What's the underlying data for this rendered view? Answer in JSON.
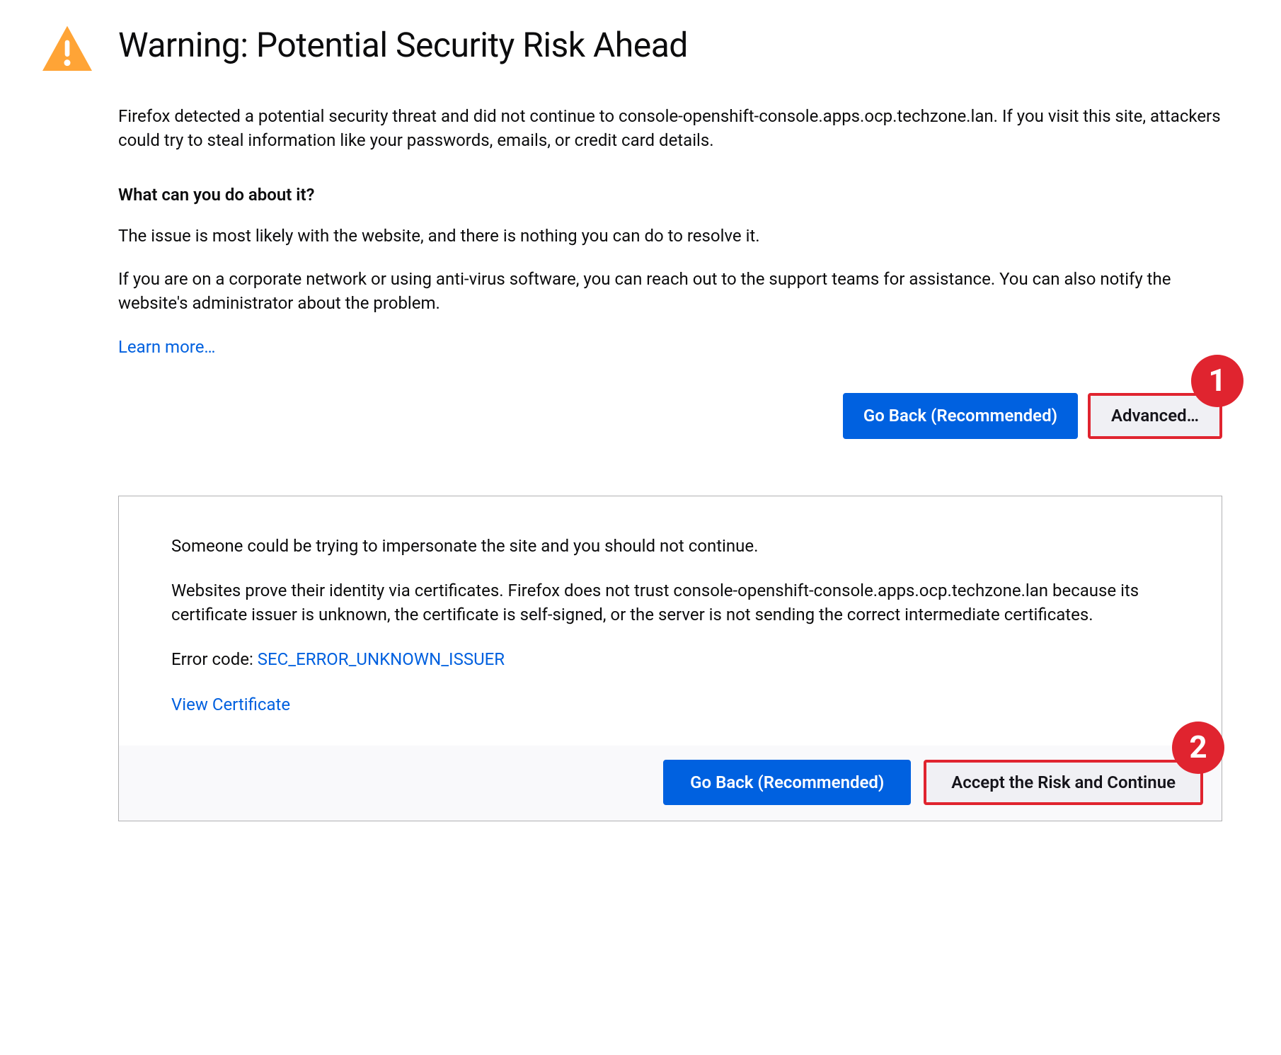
{
  "header": {
    "title": "Warning: Potential Security Risk Ahead"
  },
  "warning_text": "Firefox detected a potential security threat and did not continue to console-openshift-console.apps.ocp.techzone.lan. If you visit this site, attackers could try to steal information like your passwords, emails, or credit card details.",
  "subhead": "What can you do about it?",
  "advice_1": "The issue is most likely with the website, and there is nothing you can do to resolve it.",
  "advice_2": "If you are on a corporate network or using anti-virus software, you can reach out to the support teams for assistance. You can also notify the website's administrator about the problem.",
  "learn_more": "Learn more…",
  "buttons": {
    "go_back": "Go Back (Recommended)",
    "advanced": "Advanced…",
    "accept_risk": "Accept the Risk and Continue"
  },
  "advanced": {
    "impersonate_msg": "Someone could be trying to impersonate the site and you should not continue.",
    "cert_msg": "Websites prove their identity via certificates. Firefox does not trust console-openshift-console.apps.ocp.techzone.lan because its certificate issuer is unknown, the certificate is self-signed, or the server is not sending the correct intermediate certificates.",
    "error_label": "Error code: ",
    "error_code": "SEC_ERROR_UNKNOWN_ISSUER",
    "view_cert": "View Certificate"
  },
  "annotations": {
    "callout_1": "1",
    "callout_2": "2"
  },
  "colors": {
    "primary": "#0061e0",
    "link": "#0060df",
    "callout": "#e0242f",
    "warning_icon": "#ffa436"
  }
}
